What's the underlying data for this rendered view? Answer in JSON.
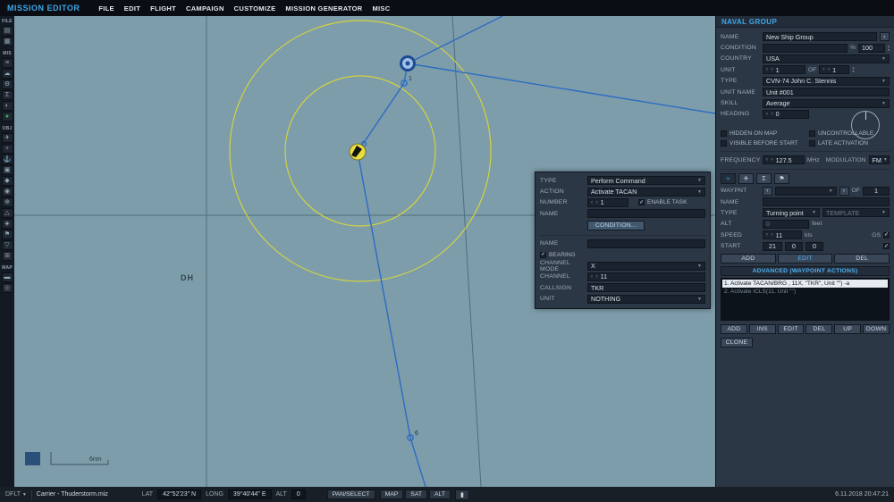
{
  "titlebar": {
    "app_title": "MISSION EDITOR",
    "menus": [
      "FILE",
      "EDIT",
      "FLIGHT",
      "CAMPAIGN",
      "CUSTOMIZE",
      "MISSION GENERATOR",
      "MISC"
    ]
  },
  "left_toolbar": {
    "sections": [
      {
        "label": "FILE",
        "icons": [
          {
            "name": "new-mission-icon",
            "glyph": "▤"
          },
          {
            "name": "open-mission-icon",
            "glyph": "▦"
          }
        ]
      },
      {
        "label": "MIS",
        "icons": [
          {
            "name": "briefing-icon",
            "glyph": "≡"
          },
          {
            "name": "weather-icon",
            "glyph": "☁"
          },
          {
            "name": "options-icon",
            "glyph": "⚙"
          },
          {
            "name": "summary-icon",
            "glyph": "Σ"
          },
          {
            "name": "time-icon",
            "glyph": "◐"
          },
          {
            "name": "goal-icon",
            "glyph": "●",
            "color": "#3fae5a"
          }
        ]
      },
      {
        "label": "OBJ",
        "icons": [
          {
            "name": "airplane-icon",
            "glyph": "✈"
          },
          {
            "name": "helicopter-icon",
            "glyph": "+"
          },
          {
            "name": "ship-icon",
            "glyph": "⚓"
          },
          {
            "name": "vehicle-icon",
            "glyph": "▣"
          },
          {
            "name": "static-object-icon",
            "glyph": "◆"
          },
          {
            "name": "zone-icon",
            "glyph": "◉"
          },
          {
            "name": "template-icon",
            "glyph": "⊕"
          },
          {
            "name": "warehouse-icon",
            "glyph": "△"
          },
          {
            "name": "bullseye-icon",
            "glyph": "◈"
          },
          {
            "name": "flag-icon",
            "glyph": "⚑"
          },
          {
            "name": "marker-icon",
            "glyph": "▽"
          },
          {
            "name": "grid-icon",
            "glyph": "⊞"
          }
        ]
      },
      {
        "label": "MAP",
        "icons": [
          {
            "name": "ruler-icon",
            "glyph": "▬"
          },
          {
            "name": "map-options-icon",
            "glyph": "◎"
          }
        ]
      }
    ]
  },
  "map": {
    "dh_label": "DH",
    "scale_label": "6nm",
    "wp1_label": "1",
    "wp6_label": "6"
  },
  "naval_group": {
    "title": "NAVAL GROUP",
    "name_label": "NAME",
    "name_value": "New Ship Group",
    "condition_label": "CONDITION",
    "condition_pct": "%",
    "condition_value": "100",
    "country_label": "COUNTRY",
    "country_value": "USA",
    "unit_label": "UNIT",
    "unit_value": "1",
    "unit_of": "OF",
    "unit_total": "1",
    "type_label": "TYPE",
    "type_value": "CVN-74 John C. Stennis",
    "unitname_label": "UNIT NAME",
    "unitname_value": "Unit #001",
    "skill_label": "SKILL",
    "skill_value": "Average",
    "heading_label": "HEADING",
    "heading_value": "0",
    "check_hidden": "HIDDEN ON MAP",
    "check_uncontrollable": "UNCONTROLLABLE",
    "check_visible": "VISIBLE BEFORE START",
    "check_late": "LATE ACTIVATION",
    "freq_label": "FREQUENCY",
    "freq_value": "127.5",
    "freq_unit": "MHz",
    "mod_label": "MODULATION",
    "mod_value": "FM",
    "waypoint": {
      "tabs": [
        {
          "name": "route-tab",
          "glyph": "≈"
        },
        {
          "name": "payload-tab",
          "glyph": "✈"
        },
        {
          "name": "summary-tab",
          "glyph": "Σ"
        },
        {
          "name": "triggers-tab",
          "glyph": "⚑"
        }
      ],
      "waypnt_label": "WAYPNT",
      "waypnt_of": "OF",
      "waypnt_total": "1",
      "name_label": "NAME",
      "name_value": "",
      "type_label": "TYPE",
      "type_value": "Turning point",
      "template_label": "TEMPLATE",
      "alt_label": "ALT",
      "alt_value": "0",
      "alt_unit": "feet",
      "speed_label": "SPEED",
      "speed_value": "11",
      "speed_unit": "kts",
      "gs_label": "GS",
      "start_label": "START",
      "start_d": "21",
      "start_h": "0",
      "start_m": "0",
      "btn_add": "ADD",
      "btn_edit": "EDIT",
      "btn_del": "DEL",
      "advanced_label": "ADVANCED (WAYPOINT ACTIONS)",
      "actions": [
        {
          "text": "1. Activate TACAN/BRG , 11X, \"TKR\", Unit \"\") -a",
          "selected": true
        },
        {
          "text": "2. Activate ICLS(11, Unit \"\")",
          "selected": false
        }
      ],
      "action_buttons": [
        "ADD",
        "INS",
        "EDIT",
        "DEL",
        "UP",
        "DOWN"
      ],
      "clone_label": "CLONE"
    }
  },
  "task_dialog": {
    "type_label": "TYPE",
    "type_value": "Perform Command",
    "action_label": "ACTION",
    "action_value": "Activate TACAN",
    "number_label": "NUMBER",
    "number_value": "1",
    "enable_task_label": "ENABLE TASK",
    "name1_label": "NAME",
    "name1_value": "",
    "condition_button": "CONDITION...",
    "name2_label": "NAME",
    "name2_value": "",
    "bearing_label": "BEARING",
    "channel_mode_label": "CHANNEL MODE",
    "channel_mode_value": "X",
    "channel_label": "CHANNEL",
    "channel_value": "11",
    "callsign_label": "CALLSIGN",
    "callsign_value": "TKR",
    "unit_label": "UNIT",
    "unit_value": "NOTHING"
  },
  "statusbar": {
    "dflt": "DFLT",
    "mission": "Carrier - Thuderstorm.miz",
    "lat_label": "LAT",
    "lat": "42°52'23\" N",
    "long_label": "LONG",
    "long": "39°40'44\" E",
    "alt_label": "ALT",
    "alt": "0",
    "pan_select": "PAN/SELECT",
    "view_buttons": [
      "MAP",
      "SAT",
      "ALT"
    ],
    "datetime": "6.11.2018 20:47:21"
  }
}
